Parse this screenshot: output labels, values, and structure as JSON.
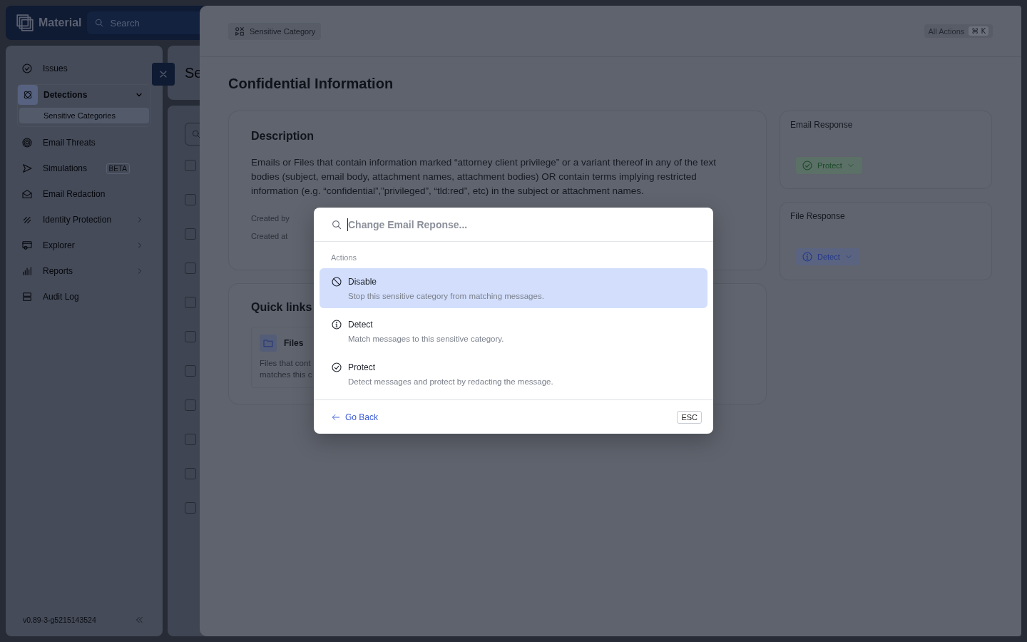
{
  "app": {
    "logo": "Material",
    "search": {
      "placeholder": "Search"
    }
  },
  "sidebar": {
    "items": [
      {
        "label": "Issues",
        "selected": false
      },
      {
        "label": "Detections",
        "selected": true,
        "expanded": true,
        "children": [
          {
            "label": "Sensitive Categories",
            "selected": true
          }
        ]
      },
      {
        "label": "Email Threats",
        "selected": false
      },
      {
        "label": "Simulations",
        "selected": false,
        "badge": "BETA"
      },
      {
        "label": "Email Redaction",
        "selected": false
      },
      {
        "label": "Identity Protection",
        "selected": false,
        "expanded": false
      },
      {
        "label": "Explorer",
        "selected": false,
        "expanded": false
      },
      {
        "label": "Reports",
        "selected": false,
        "expanded": false
      },
      {
        "label": "Audit Log",
        "selected": false
      }
    ],
    "version": "v0.89-3-g5215143524"
  },
  "main": {
    "title": "Se",
    "rows": [
      {
        "checked": false
      },
      {
        "checked": false
      },
      {
        "checked": false
      },
      {
        "checked": false
      },
      {
        "checked": false
      },
      {
        "checked": false
      },
      {
        "checked": false
      },
      {
        "checked": false
      },
      {
        "checked": false
      },
      {
        "checked": false
      },
      {
        "checked": false
      }
    ]
  },
  "sheet": {
    "breadcrumb": "Sensitive Category",
    "all_actions": {
      "label": "All Actions",
      "shortcut": "⌘ K"
    },
    "title": "Confidential Information",
    "description": {
      "heading": "Description",
      "text": "Emails or Files that contain information marked “attorney client privilege” or a variant thereof in any of the text bodies (subject, email body, attachment names, attachment bodies) OR contain terms implying restricted information (e.g. “confidential”,”privileged”, “tld:red”, etc) in the subject or attachment names.",
      "meta": [
        "Created by",
        "Created at"
      ]
    },
    "quick_links": {
      "heading": "Quick links",
      "items": [
        {
          "title": "Files",
          "lines": [
            "Files that cont",
            "matches this c"
          ]
        }
      ]
    },
    "responses": [
      {
        "heading": "Email Response",
        "value": "Protect",
        "kind": "protect"
      },
      {
        "heading": "File Response",
        "value": "Detect",
        "kind": "detect"
      }
    ]
  },
  "dialog": {
    "search": {
      "placeholder": "Change Email Reponse..."
    },
    "section": "Actions",
    "options": [
      {
        "title": "Disable",
        "text": "Stop this sensitive category from matching messages.",
        "kind": "disable",
        "selected": true
      },
      {
        "title": "Detect",
        "text": "Match messages to this sensitive category.",
        "kind": "detect",
        "selected": false
      },
      {
        "title": "Protect",
        "text": "Detect messages and protect by redacting the message.",
        "kind": "protect",
        "selected": false
      }
    ],
    "back": "Go Back",
    "esc": "ESC"
  }
}
